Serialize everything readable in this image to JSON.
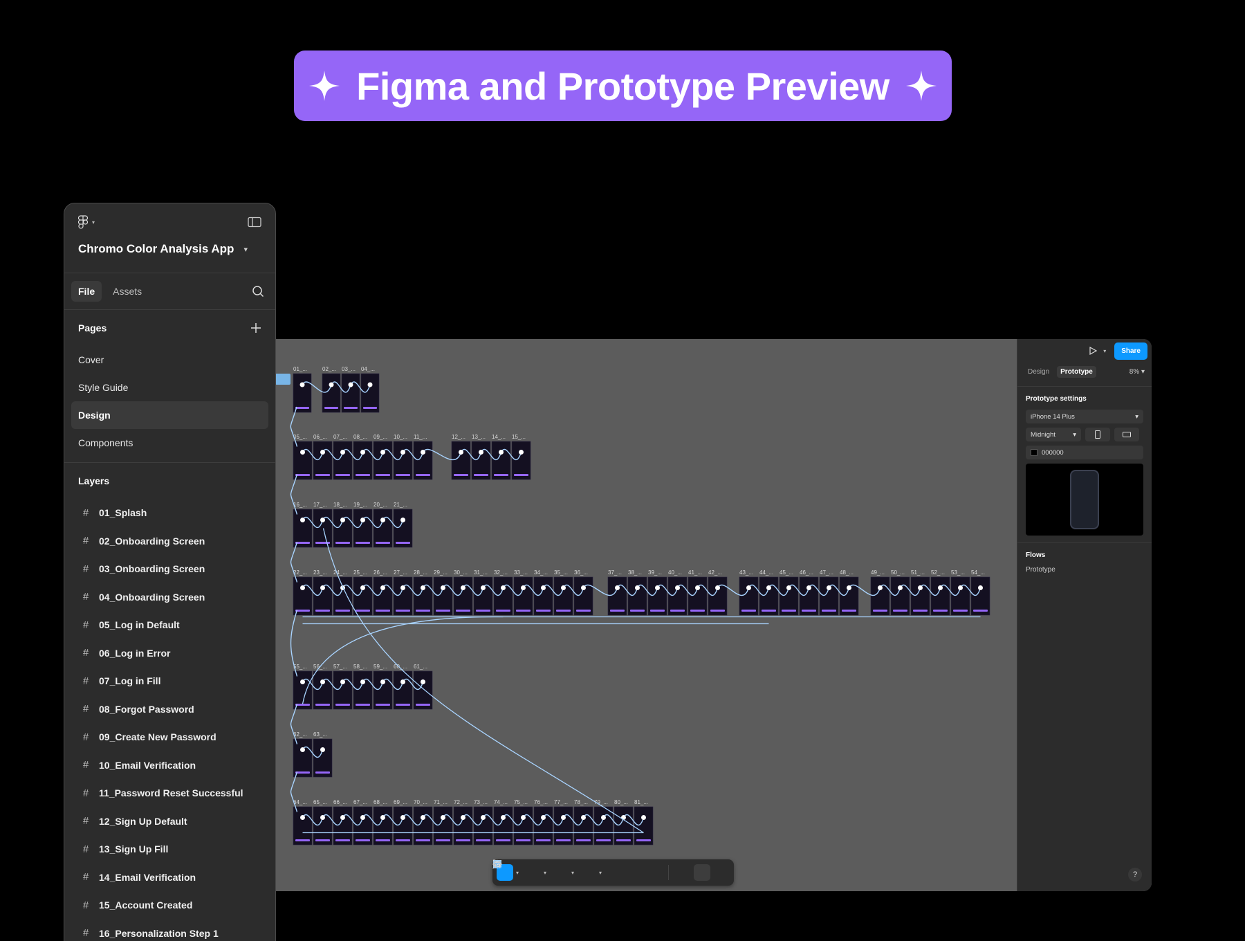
{
  "banner": {
    "title": "Figma and Prototype Preview"
  },
  "left_panel": {
    "project_title": "Chromo Color Analysis App",
    "tabs": [
      {
        "label": "File",
        "active": true
      },
      {
        "label": "Assets",
        "active": false
      }
    ],
    "pages_header": "Pages",
    "pages": [
      {
        "label": "Cover",
        "selected": false
      },
      {
        "label": "Style Guide",
        "selected": false
      },
      {
        "label": "Design",
        "selected": true
      },
      {
        "label": "Components",
        "selected": false
      }
    ],
    "layers_header": "Layers",
    "layers": [
      "01_Splash",
      "02_Onboarding Screen",
      "03_Onboarding Screen",
      "04_Onboarding Screen",
      "05_Log in Default",
      "06_Log in Error",
      "07_Log in Fill",
      "08_Forgot Password",
      "09_Create New Password",
      "10_Email Verification",
      "11_Password Reset Successful",
      "12_Sign Up Default",
      "13_Sign Up Fill",
      "14_Email Verification",
      "15_Account Created",
      "16_Personalization Step 1"
    ]
  },
  "right_panel": {
    "share_label": "Share",
    "tabs": [
      {
        "label": "Design",
        "active": false
      },
      {
        "label": "Prototype",
        "active": true
      }
    ],
    "zoom": "8%",
    "settings_header": "Prototype settings",
    "device": "iPhone 14 Plus",
    "device_color": "Midnight",
    "background_hex": "000000",
    "flows_header": "Flows",
    "flow_name": "Prototype",
    "help_label": "?"
  },
  "canvas": {
    "rows": [
      {
        "labels": [
          "01_...",
          "02_...",
          "03_...",
          "04_..."
        ]
      },
      {
        "labels": [
          "05_...",
          "06_...",
          "07_...",
          "08_...",
          "09_...",
          "10_...",
          "11_...",
          "12_...",
          "13_...",
          "14_...",
          "15_..."
        ]
      },
      {
        "labels": [
          "16_...",
          "17_...",
          "18_...",
          "19_...",
          "20_...",
          "21_..."
        ]
      },
      {
        "labels": [
          "22_...",
          "23_...",
          "24_...",
          "25_...",
          "26_...",
          "27_...",
          "28_...",
          "29_...",
          "30_...",
          "31_...",
          "32_...",
          "33_...",
          "34_...",
          "35_...",
          "36_...",
          "37_...",
          "38_...",
          "39_...",
          "40_...",
          "41_...",
          "42_...",
          "43_...",
          "44_...",
          "45_...",
          "46_...",
          "47_...",
          "48_...",
          "49_...",
          "50_...",
          "51_...",
          "52_...",
          "53_...",
          "54_..."
        ]
      },
      {
        "labels": [
          "55_...",
          "56_...",
          "57_...",
          "58_...",
          "59_...",
          "60_...",
          "61_..."
        ]
      },
      {
        "labels": [
          "62_...",
          "63_..."
        ]
      },
      {
        "labels": [
          "64_...",
          "65_...",
          "66_...",
          "67_...",
          "68_...",
          "69_...",
          "70_...",
          "71_...",
          "72_...",
          "73_...",
          "74_...",
          "75_...",
          "76_...",
          "77_...",
          "78_...",
          "79_...",
          "80_...",
          "81_..."
        ]
      }
    ]
  },
  "colors": {
    "accent": "#9566f7",
    "figma_blue": "#0d99ff",
    "flow_line": "#a9d4ff",
    "canvas": "#5c5c5c",
    "panel": "#2c2c2c"
  }
}
